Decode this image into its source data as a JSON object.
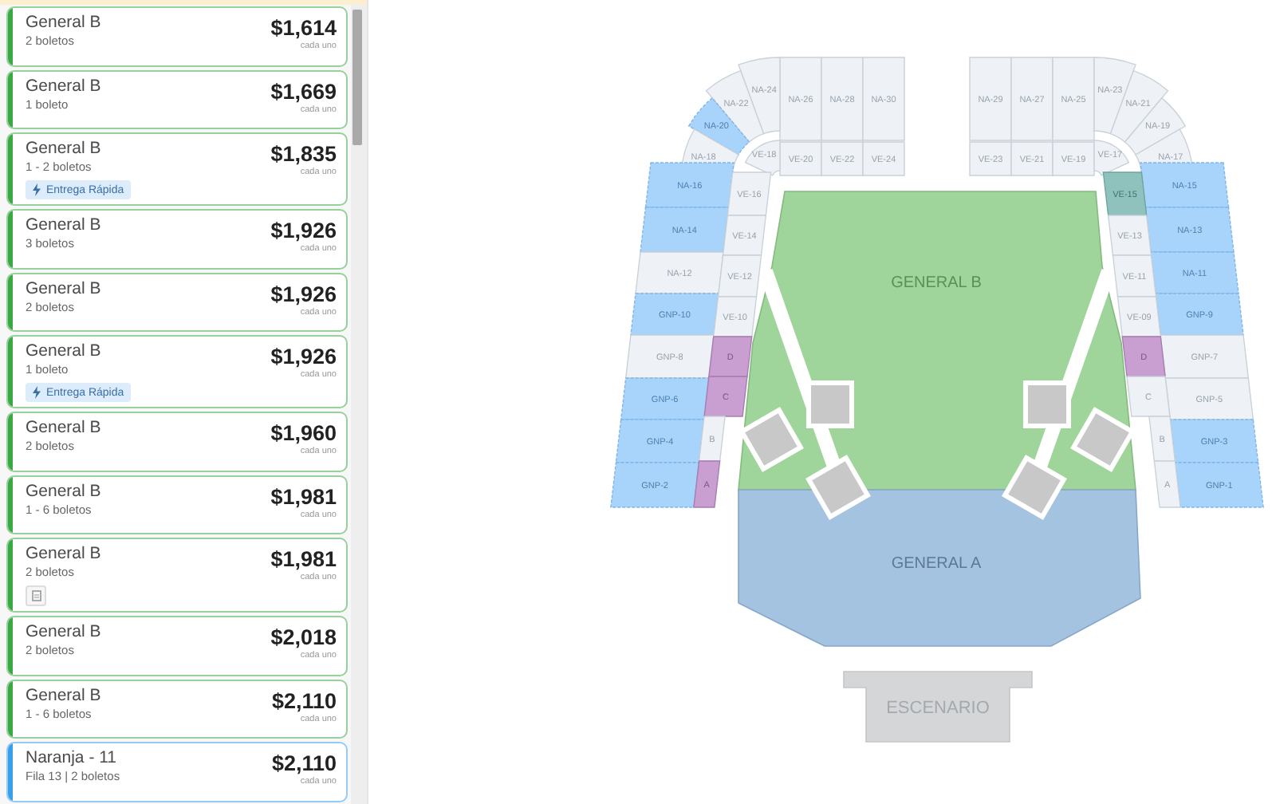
{
  "listings": [
    {
      "title": "General B",
      "subtitle": "2 boletos",
      "price": "$1,614",
      "price_note": "cada uno",
      "color": "#3aa843"
    },
    {
      "title": "General B",
      "subtitle": "1 boleto",
      "price": "$1,669",
      "price_note": "cada uno",
      "color": "#3aa843"
    },
    {
      "title": "General B",
      "subtitle": "1 - 2 boletos",
      "price": "$1,835",
      "price_note": "cada uno",
      "color": "#3aa843",
      "badge": {
        "kind": "delivery",
        "text": "Entrega Rápida"
      }
    },
    {
      "title": "General B",
      "subtitle": "3 boletos",
      "price": "$1,926",
      "price_note": "cada uno",
      "color": "#3aa843"
    },
    {
      "title": "General B",
      "subtitle": "2 boletos",
      "price": "$1,926",
      "price_note": "cada uno",
      "color": "#3aa843"
    },
    {
      "title": "General B",
      "subtitle": "1 boleto",
      "price": "$1,926",
      "price_note": "cada uno",
      "color": "#3aa843",
      "badge": {
        "kind": "delivery",
        "text": "Entrega Rápida"
      }
    },
    {
      "title": "General B",
      "subtitle": "2 boletos",
      "price": "$1,960",
      "price_note": "cada uno",
      "color": "#3aa843"
    },
    {
      "title": "General B",
      "subtitle": "1 - 6 boletos",
      "price": "$1,981",
      "price_note": "cada uno",
      "color": "#3aa843"
    },
    {
      "title": "General B",
      "subtitle": "2 boletos",
      "price": "$1,981",
      "price_note": "cada uno",
      "color": "#3aa843",
      "badge": {
        "kind": "document"
      }
    },
    {
      "title": "General B",
      "subtitle": "2 boletos",
      "price": "$2,018",
      "price_note": "cada uno",
      "color": "#3aa843"
    },
    {
      "title": "General B",
      "subtitle": "1 - 6 boletos",
      "price": "$2,110",
      "price_note": "cada uno",
      "color": "#3aa843"
    },
    {
      "title": "Naranja - 11",
      "subtitle": "Fila 13 | 2 boletos",
      "price": "$2,110",
      "price_note": "cada uno",
      "color": "#3b9ee8"
    }
  ],
  "map": {
    "zones": [
      {
        "label": "GENERAL B",
        "kind": "general_b"
      },
      {
        "label": "GENERAL A",
        "kind": "general_a"
      }
    ],
    "stage": {
      "label": "ESCENARIO"
    },
    "sections": [
      {
        "label": "NA-26",
        "color": "#eef2f6"
      },
      {
        "label": "NA-28",
        "color": "#eef2f6"
      },
      {
        "label": "NA-30",
        "color": "#eef2f6"
      },
      {
        "label": "VE-20",
        "color": "#eef2f6"
      },
      {
        "label": "VE-22",
        "color": "#eef2f6"
      },
      {
        "label": "VE-24",
        "color": "#eef2f6"
      },
      {
        "label": "NA-24",
        "color": "#eef2f6"
      },
      {
        "label": "NA-22",
        "color": "#eef2f6"
      },
      {
        "label": "NA-20",
        "color": "#a8d4fb"
      },
      {
        "label": "NA-18",
        "color": "#eef2f6"
      },
      {
        "label": "VE-18",
        "color": "#eef2f6"
      },
      {
        "label": "NA-16",
        "color": "#a8d4fb"
      },
      {
        "label": "NA-14",
        "color": "#a8d4fb"
      },
      {
        "label": "NA-12",
        "color": "#eef2f6"
      },
      {
        "label": "GNP-10",
        "color": "#a8d4fb"
      },
      {
        "label": "GNP-8",
        "color": "#eef2f6"
      },
      {
        "label": "GNP-6",
        "color": "#a8d4fb"
      },
      {
        "label": "GNP-4",
        "color": "#a8d4fb"
      },
      {
        "label": "GNP-2",
        "color": "#a8d4fb"
      },
      {
        "label": "VE-16",
        "color": "#eef2f6"
      },
      {
        "label": "VE-14",
        "color": "#eef2f6"
      },
      {
        "label": "VE-12",
        "color": "#eef2f6"
      },
      {
        "label": "VE-10",
        "color": "#eef2f6"
      },
      {
        "label": "D",
        "color": "#c99fd1"
      },
      {
        "label": "C",
        "color": "#c99fd1"
      },
      {
        "label": "B",
        "color": "#eef2f6"
      },
      {
        "label": "A",
        "color": "#c99fd1"
      },
      {
        "label": "NA-29",
        "color": "#eef2f6"
      },
      {
        "label": "NA-27",
        "color": "#eef2f6"
      },
      {
        "label": "NA-25",
        "color": "#eef2f6"
      },
      {
        "label": "VE-23",
        "color": "#eef2f6"
      },
      {
        "label": "VE-21",
        "color": "#eef2f6"
      },
      {
        "label": "VE-19",
        "color": "#eef2f6"
      },
      {
        "label": "NA-23",
        "color": "#eef2f6"
      },
      {
        "label": "NA-21",
        "color": "#eef2f6"
      },
      {
        "label": "NA-19",
        "color": "#eef2f6"
      },
      {
        "label": "VE-17",
        "color": "#eef2f6"
      },
      {
        "label": "NA-17",
        "color": "#eef2f6"
      },
      {
        "label": "NA-15",
        "color": "#a8d4fb"
      },
      {
        "label": "NA-13",
        "color": "#a8d4fb"
      },
      {
        "label": "NA-11",
        "color": "#a8d4fb"
      },
      {
        "label": "GNP-9",
        "color": "#a8d4fb"
      },
      {
        "label": "GNP-7",
        "color": "#eef2f6"
      },
      {
        "label": "GNP-5",
        "color": "#eef2f6"
      },
      {
        "label": "GNP-3",
        "color": "#a8d4fb"
      },
      {
        "label": "GNP-1",
        "color": "#a8d4fb"
      },
      {
        "label": "VE-15",
        "color": "#8fc2bd"
      },
      {
        "label": "VE-13",
        "color": "#eef2f6"
      },
      {
        "label": "VE-11",
        "color": "#eef2f6"
      },
      {
        "label": "VE-09",
        "color": "#eef2f6"
      },
      {
        "label": "D",
        "color": "#c99fd1"
      },
      {
        "label": "C",
        "color": "#eef2f6"
      },
      {
        "label": "B",
        "color": "#eef2f6"
      },
      {
        "label": "A",
        "color": "#eef2f6"
      }
    ]
  }
}
